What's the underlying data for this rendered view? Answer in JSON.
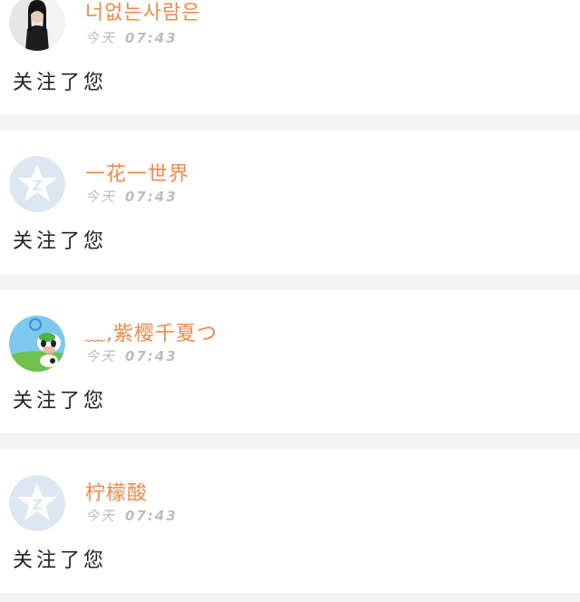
{
  "notifications": [
    {
      "avatar": "profile-photo-woman-icon",
      "username": "너없는사람은",
      "date_label": "今天",
      "time": "07:43",
      "action": "关注了您"
    },
    {
      "avatar": "default-star-avatar-icon",
      "username": "一花一世界",
      "date_label": "今天",
      "time": "07:43",
      "action": "关注了您"
    },
    {
      "avatar": "cartoon-cow-avatar-icon",
      "username": "﹏,紫樱千夏つ",
      "date_label": "今天",
      "time": "07:43",
      "action": "关注了您"
    },
    {
      "avatar": "default-star-avatar-icon",
      "username": "柠檬酸",
      "date_label": "今天",
      "time": "07:43",
      "action": "关注了您"
    }
  ],
  "colors": {
    "username": "#f08848",
    "time": "#bdbdbd",
    "action_text": "#222222",
    "separator": "#f4f4f4",
    "card_background": "#ffffff"
  }
}
